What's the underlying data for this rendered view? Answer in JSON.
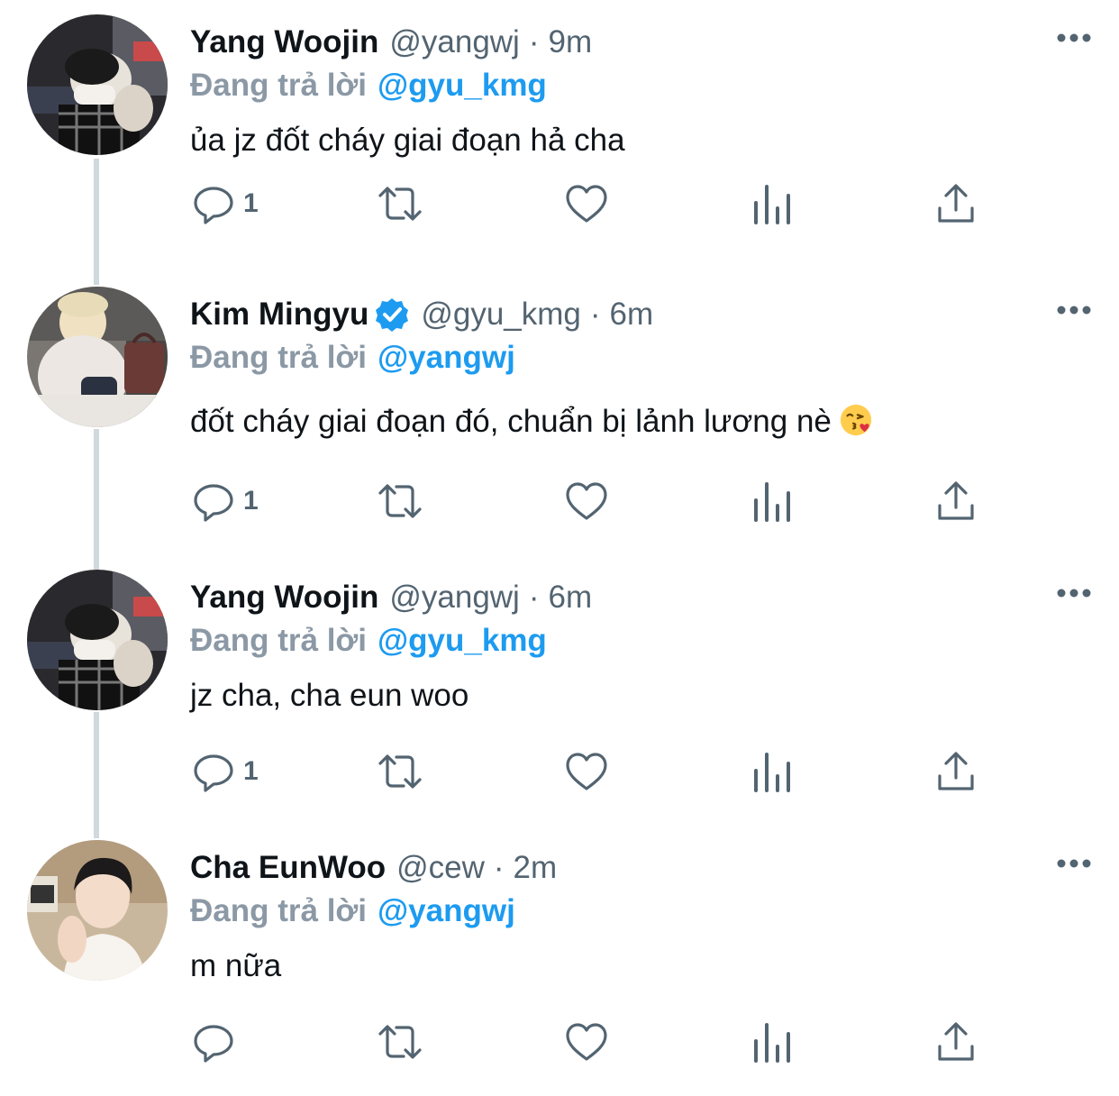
{
  "colors": {
    "text": "#0f1419",
    "muted": "#536471",
    "link": "#1d9bf0",
    "reply_prefix": "#8b98a5",
    "thread_line": "#cfd9de",
    "verified": "#1d9bf0"
  },
  "tweets": [
    {
      "name": "Yang Woojin",
      "handle": "@yangwj",
      "separator": "·",
      "time": "9m",
      "verified": false,
      "reply_prefix": "Đang trả lời",
      "reply_to": "@gyu_kmg",
      "text": "ủa jz đốt cháy giai đoạn hả cha",
      "reply_count": "1",
      "avatar_icon": "avatar-yang-woojin"
    },
    {
      "name": "Kim Mingyu",
      "handle": "@gyu_kmg",
      "separator": "·",
      "time": "6m",
      "verified": true,
      "reply_prefix": "Đang trả lời",
      "reply_to": "@yangwj",
      "text": "đốt cháy giai đoạn đó, chuẩn bị lảnh lương nè",
      "text_emoji": "face-blowing-a-kiss-icon",
      "reply_count": "1",
      "avatar_icon": "avatar-kim-mingyu"
    },
    {
      "name": "Yang Woojin",
      "handle": "@yangwj",
      "separator": "·",
      "time": "6m",
      "verified": false,
      "reply_prefix": "Đang trả lời",
      "reply_to": "@gyu_kmg",
      "text": "jz cha, cha eun woo",
      "reply_count": "1",
      "avatar_icon": "avatar-yang-woojin"
    },
    {
      "name": "Cha EunWoo",
      "handle": "@cew",
      "separator": "·",
      "time": "2m",
      "verified": false,
      "reply_prefix": "Đang trả lời",
      "reply_to": "@yangwj",
      "text": "m nữa",
      "reply_count": "",
      "avatar_icon": "avatar-cha-eunwoo"
    }
  ],
  "icons": {
    "reply": "reply-icon",
    "retweet": "retweet-icon",
    "like": "heart-icon",
    "views": "analytics-icon",
    "share": "share-icon",
    "more": "more-dots-icon"
  }
}
